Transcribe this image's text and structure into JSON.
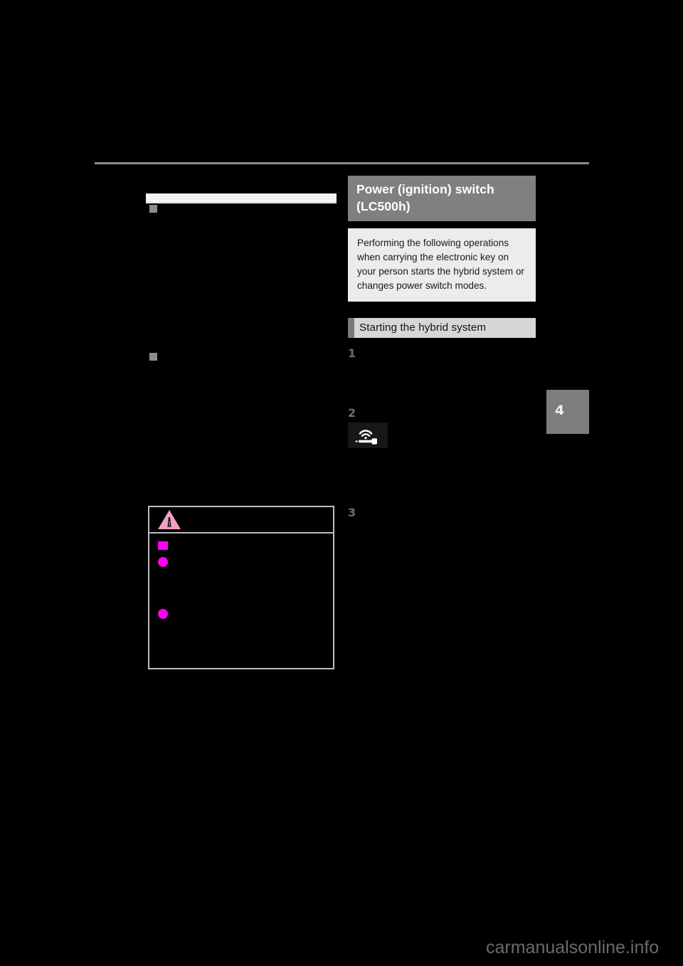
{
  "page": {
    "background_color": "#000000",
    "rule_color": "#8c8c8c",
    "watermark": "carmanualsonline.info",
    "chapter_tab": "4"
  },
  "left_column": {
    "section1": {
      "bullet": "square-bullet",
      "heading": "",
      "body": ""
    },
    "section2": {
      "bullet": "square-bullet",
      "heading": "",
      "body": ""
    },
    "caution_box": {
      "icon": "warning-triangle-icon",
      "icon_color": "#f2a0c8",
      "title": "",
      "subhead_bullet_color": "#ff00f0",
      "subhead": "",
      "items": [
        {
          "bullet": "round-bullet",
          "text": ""
        },
        {
          "bullet": "round-bullet",
          "text": ""
        }
      ]
    }
  },
  "right_column": {
    "section_title": "Power (ignition) switch (LC500h)",
    "section_title_bg": "#808080",
    "intro": "Performing the following operations when carrying the electronic key on your person starts the hybrid system or changes power switch modes.",
    "intro_bg": "#ececec",
    "subheading": "Starting the hybrid system",
    "subheading_bg": "#d6d6d6",
    "subheading_bar": "#7a7a7a",
    "steps": [
      {
        "number": "1",
        "text": ""
      },
      {
        "number": "2",
        "text": "",
        "indicator_icon": "electronic-key-signal-icon"
      },
      {
        "number": "3",
        "text": ""
      }
    ]
  }
}
